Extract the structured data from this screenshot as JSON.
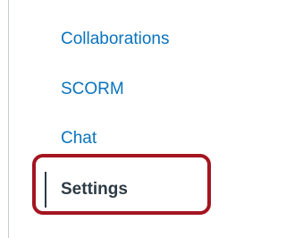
{
  "course_nav": {
    "items": [
      {
        "label": "Collaborations",
        "active": false
      },
      {
        "label": "SCORM",
        "active": false
      },
      {
        "label": "Chat",
        "active": false
      },
      {
        "label": "Settings",
        "active": true
      }
    ]
  },
  "colors": {
    "link": "#0a73bd",
    "active_text": "#2d3b45",
    "highlight": "#a31520",
    "border": "#c7cdd1"
  }
}
